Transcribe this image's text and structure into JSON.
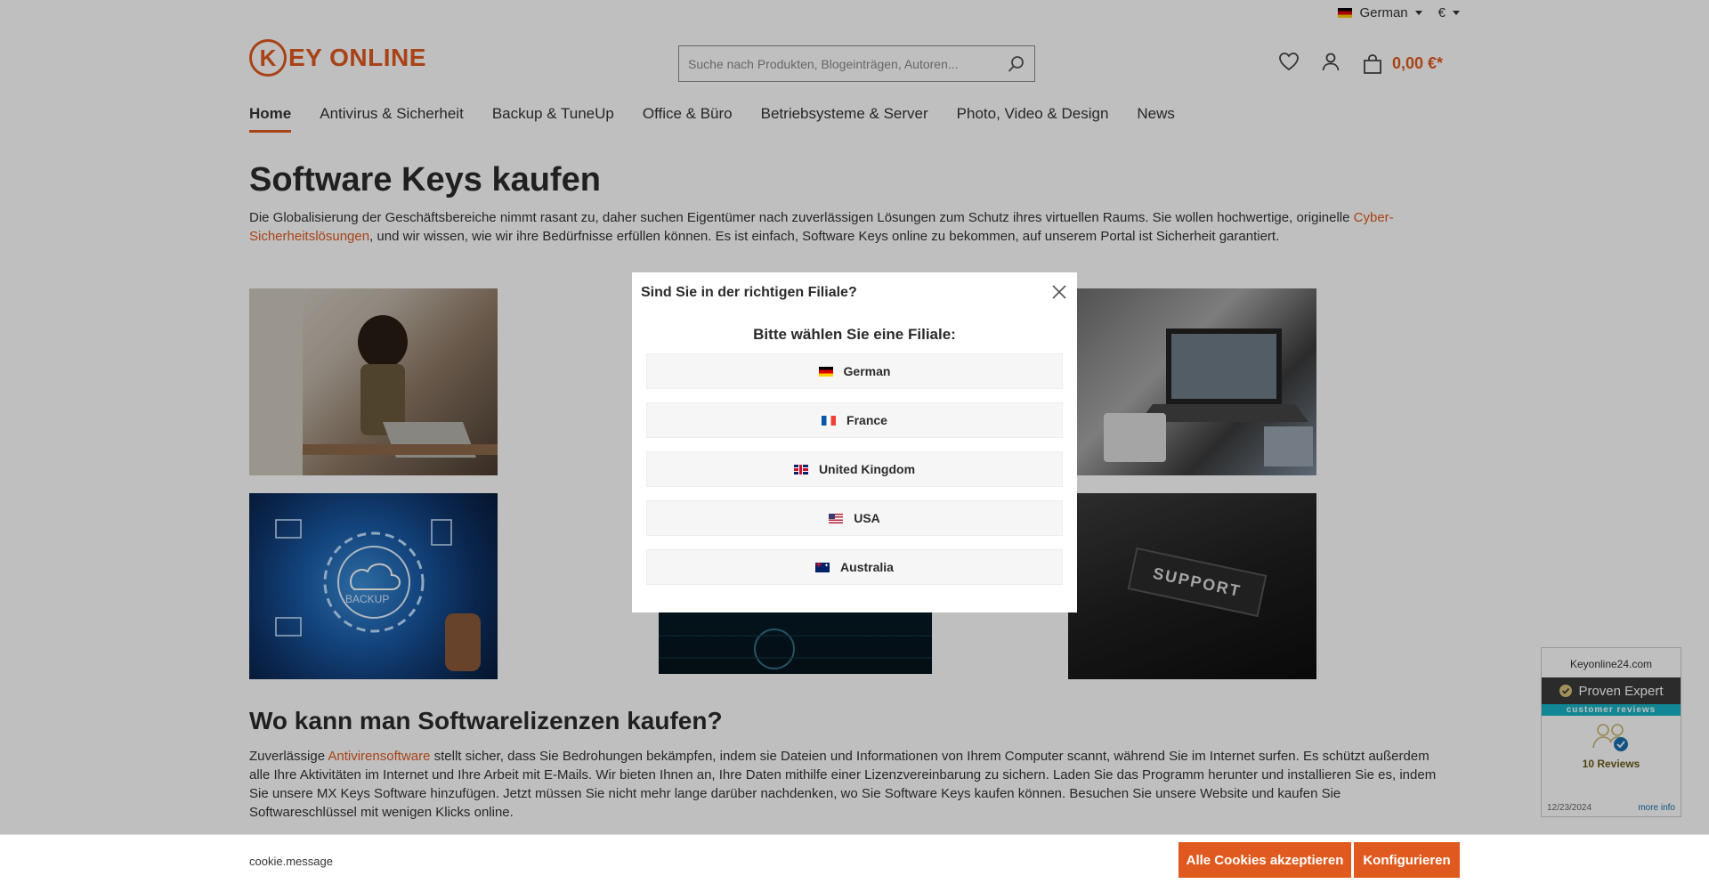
{
  "topbar": {
    "language": "German",
    "currency": "€"
  },
  "logo": {
    "letter": "K",
    "text": "EY ONLINE"
  },
  "search": {
    "placeholder": "Suche nach Produkten, Blogeinträgen, Autoren..."
  },
  "cart": {
    "amount": "0,00 €*"
  },
  "nav": {
    "items": [
      {
        "label": "Home"
      },
      {
        "label": "Antivirus & Sicherheit"
      },
      {
        "label": "Backup & TuneUp"
      },
      {
        "label": "Office & Büro"
      },
      {
        "label": "Betriebsysteme & Server"
      },
      {
        "label": "Photo, Video & Design"
      },
      {
        "label": "News"
      }
    ]
  },
  "main": {
    "title": "Software Keys kaufen",
    "intro_before": "Die Globalisierung der Geschäftsbereiche nimmt rasant zu, daher suchen Eigentümer nach zuverlässigen Lösungen zum Schutz ihres virtuellen Raums. Sie wollen hochwertige, originelle ",
    "intro_link": "Cyber-Sicherheitslösungen",
    "intro_after": ", und wir wissen, wie wir ihre Bedürfnisse erfüllen können. Es ist einfach, Software Keys online zu bekommen, auf unserem Portal ist Sicherheit garantiert.",
    "image_backup_text": "BACKUP",
    "image_support_text": "SUPPORT",
    "h2": "Wo kann man Softwarelizenzen kaufen?",
    "para2_before": "Zuverlässige ",
    "para2_link": "Antivirensoftware",
    "para2_after": " stellt sicher, dass Sie Bedrohungen bekämpfen, indem sie Dateien und Informationen von Ihrem Computer scannt, während Sie im Internet surfen. Es schützt außerdem alle Ihre Aktivitäten im Internet und Ihre Arbeit mit E-Mails. Wir bieten Ihnen an, Ihre Daten mithilfe einer Lizenzvereinbarung zu sichern. Laden Sie das Programm herunter und installieren Sie es, indem Sie unsere MX Keys Software hinzufügen. Jetzt müssen Sie nicht mehr lange darüber nachdenken, wo Sie Software Keys kaufen können. Besuchen Sie unsere Website und kaufen Sie Softwareschlüssel mit wenigen Klicks online."
  },
  "modal": {
    "title": "Sind Sie in der richtigen Filiale?",
    "subtitle": "Bitte wählen Sie eine Filiale:",
    "options": [
      {
        "label": "German",
        "flag": "de"
      },
      {
        "label": "France",
        "flag": "fr"
      },
      {
        "label": "United Kingdom",
        "flag": "uk"
      },
      {
        "label": "USA",
        "flag": "us"
      },
      {
        "label": "Australia",
        "flag": "au"
      }
    ]
  },
  "widget": {
    "site": "Keyonline24.com",
    "brand": "Proven Expert",
    "tagline": "customer reviews",
    "reviews": "10 Reviews",
    "date": "12/23/2024",
    "more": "more info"
  },
  "cookie": {
    "message": "cookie.message",
    "accept_label": "Alle Cookies akzeptieren",
    "configure_label": "Konfigurieren"
  },
  "colors": {
    "accent": "#e05a1f",
    "overlay": "rgba(0,0,0,0.25)"
  }
}
